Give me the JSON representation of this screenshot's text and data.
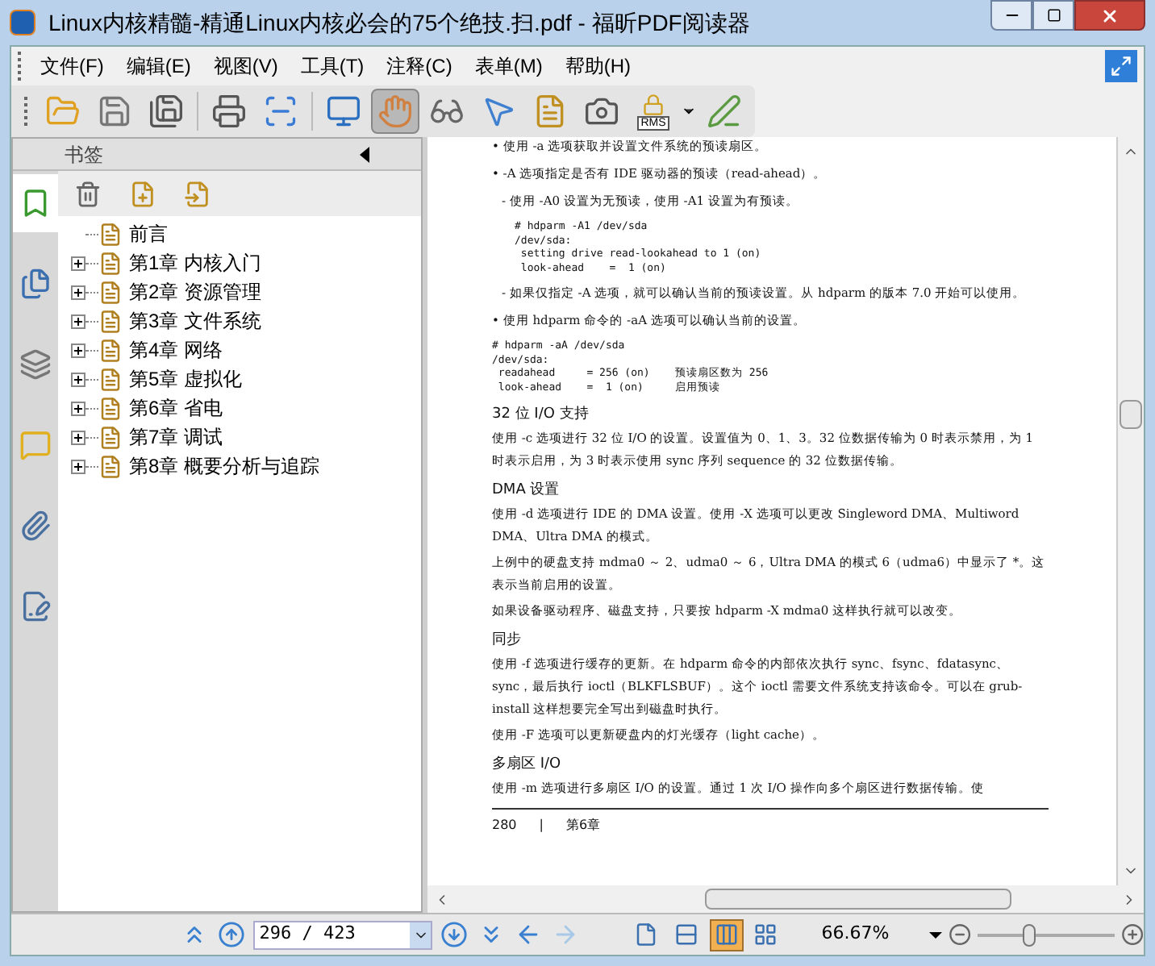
{
  "window": {
    "title": "Linux内核精髓-精通Linux内核必会的75个绝技.扫.pdf - 福昕PDF阅读器"
  },
  "menu": [
    "文件(F)",
    "编辑(E)",
    "视图(V)",
    "工具(T)",
    "注释(C)",
    "表单(M)",
    "帮助(H)"
  ],
  "toolbar": [
    {
      "kind": "open",
      "selected": false
    },
    {
      "kind": "save",
      "selected": false
    },
    {
      "kind": "saveas",
      "selected": false
    },
    {
      "kind": "sep"
    },
    {
      "kind": "print",
      "selected": false
    },
    {
      "kind": "scan",
      "selected": false
    },
    {
      "kind": "sep"
    },
    {
      "kind": "fullscreen",
      "selected": false
    },
    {
      "kind": "hand",
      "selected": true
    },
    {
      "kind": "zoomtool",
      "selected": false
    },
    {
      "kind": "select",
      "selected": false
    },
    {
      "kind": "textselect",
      "selected": false
    },
    {
      "kind": "snapshot",
      "selected": false
    },
    {
      "kind": "rms",
      "selected": false,
      "label": "RMS"
    },
    {
      "kind": "caret"
    },
    {
      "kind": "sign",
      "selected": false
    }
  ],
  "sidebar": {
    "title": "书签",
    "tabs": [
      {
        "kind": "bookmarks",
        "selected": true
      },
      {
        "kind": "pages",
        "selected": false
      },
      {
        "kind": "layers",
        "selected": false
      },
      {
        "kind": "comments",
        "selected": false
      },
      {
        "kind": "attachments",
        "selected": false
      },
      {
        "kind": "signatures",
        "selected": false
      }
    ],
    "actions": [
      {
        "kind": "delete"
      },
      {
        "kind": "add"
      },
      {
        "kind": "move"
      }
    ],
    "bookmarks": [
      {
        "label": "前言",
        "expandable": false
      },
      {
        "label": "第1章 内核入门",
        "expandable": true
      },
      {
        "label": "第2章 资源管理",
        "expandable": true
      },
      {
        "label": "第3章 文件系统",
        "expandable": true
      },
      {
        "label": "第4章 网络",
        "expandable": true
      },
      {
        "label": "第5章 虚拟化",
        "expandable": true
      },
      {
        "label": "第6章 省电",
        "expandable": true
      },
      {
        "label": "第7章 调试",
        "expandable": true
      },
      {
        "label": "第8章 概要分析与追踪",
        "expandable": true
      }
    ]
  },
  "document": {
    "blocks": [
      {
        "kind": "bullet",
        "text": "• 使用 -a 选项获取并设置文件系统的预读扇区。"
      },
      {
        "kind": "bullet",
        "text": "• -A 选项指定是否有 IDE 驱动器的预读（read-ahead）。"
      },
      {
        "kind": "sub",
        "text": "- 使用 -A0 设置为无预读，使用 -A1 设置为有预读。"
      },
      {
        "kind": "code",
        "indent": true,
        "lines": [
          "# hdparm -A1 /dev/sda",
          "/dev/sda:",
          " setting drive read-lookahead to 1 (on)",
          " look-ahead    =  1 (on)"
        ]
      },
      {
        "kind": "sub",
        "text": "- 如果仅指定 -A 选项，就可以确认当前的预读设置。从 hdparm 的版本 7.0 开始可以使用。"
      },
      {
        "kind": "bullet",
        "text": "• 使用 hdparm 命令的 -aA 选项可以确认当前的设置。"
      },
      {
        "kind": "code",
        "indent": false,
        "lines": [
          "# hdparm -aA /dev/sda",
          "/dev/sda:",
          " readahead     = 256 (on)    预读扇区数为 256",
          " look-ahead    =  1 (on)     启用预读"
        ]
      },
      {
        "kind": "heading",
        "text": "32 位 I/O 支持"
      },
      {
        "kind": "para",
        "text": "使用 -c 选项进行 32 位 I/O 的设置。设置值为 0、1、3。32 位数据传输为 0 时表示禁用，为 1 时表示启用，为 3 时表示使用 sync 序列 sequence 的 32 位数据传输。"
      },
      {
        "kind": "heading",
        "text": "DMA 设置"
      },
      {
        "kind": "para",
        "text": "使用 -d 选项进行 IDE 的 DMA 设置。使用 -X 选项可以更改 Singleword DMA、Multiword DMA、Ultra DMA 的模式。"
      },
      {
        "kind": "para",
        "text": "上例中的硬盘支持 mdma0 ～ 2、udma0 ～ 6，Ultra DMA 的模式 6（udma6）中显示了 *。这表示当前启用的设置。"
      },
      {
        "kind": "para",
        "text": "如果设备驱动程序、磁盘支持，只要按 hdparm -X mdma0 这样执行就可以改变。"
      },
      {
        "kind": "heading",
        "text": "同步"
      },
      {
        "kind": "para",
        "text": "使用 -f 选项进行缓存的更新。在 hdparm 命令的内部依次执行 sync、fsync、fdatasync、sync，最后执行 ioctl（BLKFLSBUF）。这个 ioctl 需要文件系统支持该命令。可以在 grub-install 这样想要完全写出到磁盘时执行。"
      },
      {
        "kind": "para",
        "text": "使用 -F 选项可以更新硬盘内的灯光缓存（light cache）。"
      },
      {
        "kind": "heading",
        "text": "多扇区 I/O"
      },
      {
        "kind": "para",
        "text": "使用 -m 选项进行多扇区 I/O 的设置。通过 1 次 I/O 操作向多个扇区进行数据传输。使"
      },
      {
        "kind": "footer",
        "page": "280",
        "separator": "|",
        "chapter": "第6章"
      }
    ]
  },
  "status": {
    "page_field": "296 / 423",
    "nav": [
      {
        "kind": "first",
        "disabled": false
      },
      {
        "kind": "prev",
        "disabled": false
      }
    ],
    "nav2": [
      {
        "kind": "next",
        "disabled": false
      },
      {
        "kind": "last",
        "disabled": false
      },
      {
        "kind": "back",
        "disabled": false
      },
      {
        "kind": "forward",
        "disabled": true
      }
    ],
    "views": [
      {
        "kind": "single",
        "selected": false
      },
      {
        "kind": "continuous",
        "selected": false
      },
      {
        "kind": "facing",
        "selected": true
      },
      {
        "kind": "thumbs",
        "selected": false
      }
    ],
    "zoom": "66.67%",
    "zoom_slider": {
      "level": 0.38
    }
  }
}
